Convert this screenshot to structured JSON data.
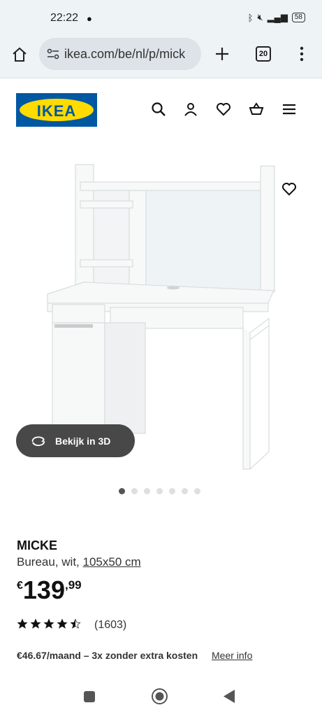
{
  "status_bar": {
    "time": "22:22",
    "battery": "58"
  },
  "browser": {
    "url": "ikea.com/be/nl/p/mick",
    "tab_count": "20"
  },
  "header": {
    "logo_text": "IKEA",
    "brand_blue": "#0058a3",
    "brand_yellow": "#ffdb00"
  },
  "gallery": {
    "view_3d_label": "Bekijk in 3D",
    "dot_count": 7,
    "active_dot": 0
  },
  "product": {
    "name": "MICKE",
    "desc_prefix": "Bureau, wit, ",
    "dimensions": "105x50 cm",
    "price_currency": "€",
    "price_integer": "139",
    "price_decimal": ",99",
    "rating": 4.5,
    "rating_count": "(1603)",
    "installment_text": "€46.67/maand – 3x zonder extra kosten",
    "more_info_label": "Meer info"
  }
}
